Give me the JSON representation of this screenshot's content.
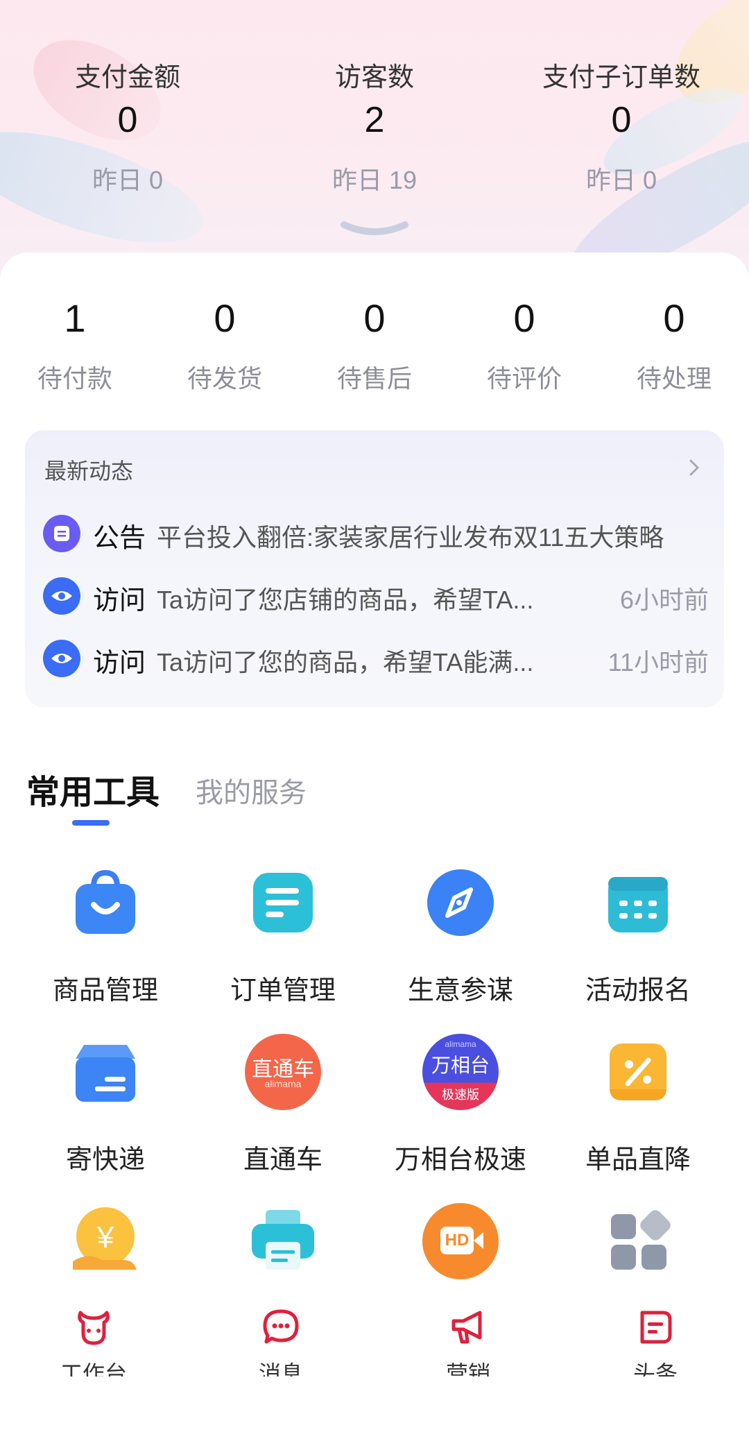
{
  "stats": [
    {
      "label": "支付金额",
      "value": "0",
      "yesterday": "昨日 0"
    },
    {
      "label": "访客数",
      "value": "2",
      "yesterday": "昨日 19"
    },
    {
      "label": "支付子订单数",
      "value": "0",
      "yesterday": "昨日 0"
    }
  ],
  "orders": [
    {
      "count": "1",
      "label": "待付款"
    },
    {
      "count": "0",
      "label": "待发货"
    },
    {
      "count": "0",
      "label": "待售后"
    },
    {
      "count": "0",
      "label": "待评价"
    },
    {
      "count": "0",
      "label": "待处理"
    }
  ],
  "news": {
    "title": "最新动态",
    "items": [
      {
        "icon": "announcement-icon",
        "tag": "公告",
        "text": "平台投入翻倍:家装家居行业发布双11五大策略",
        "time": ""
      },
      {
        "icon": "eye-icon",
        "tag": "访问",
        "text": "Ta访问了您店铺的商品，希望TA...",
        "time": "6小时前"
      },
      {
        "icon": "eye-icon",
        "tag": "访问",
        "text": "Ta访问了您的商品，希望TA能满...",
        "time": "11小时前"
      }
    ]
  },
  "tabs": {
    "active": "常用工具",
    "inactive": "我的服务"
  },
  "tools": [
    {
      "name": "商品管理",
      "icon": "shopping-bag-icon"
    },
    {
      "name": "订单管理",
      "icon": "order-list-icon"
    },
    {
      "name": "生意参谋",
      "icon": "compass-icon"
    },
    {
      "name": "活动报名",
      "icon": "calendar-icon"
    },
    {
      "name": "寄快递",
      "icon": "delivery-box-icon"
    },
    {
      "name": "直通车",
      "icon": "zhitongche-logo"
    },
    {
      "name": "万相台极速",
      "icon": "wanxiangtai-logo"
    },
    {
      "name": "单品直降",
      "icon": "discount-coupon-icon"
    },
    {
      "name": "",
      "icon": "yuan-hand-icon"
    },
    {
      "name": "",
      "icon": "printer-icon"
    },
    {
      "name": "",
      "icon": "hd-video-icon"
    },
    {
      "name": "",
      "icon": "more-apps-icon"
    }
  ],
  "logo_text": {
    "zhitongche": "直通车",
    "zhitongche_sub": "alimama",
    "wanxiangtai": "万相台",
    "wanxiangtai_top": "alimama",
    "wanxiangtai_badge": "极速版",
    "hd": "HD",
    "yuan": "¥"
  },
  "nav": [
    {
      "label": "工作台",
      "icon": "bull-head-icon"
    },
    {
      "label": "消息",
      "icon": "chat-bubble-icon"
    },
    {
      "label": "营销",
      "icon": "megaphone-icon"
    },
    {
      "label": "头条",
      "icon": "news-icon"
    }
  ],
  "colors": {
    "accent": "#3a6cf5",
    "nav": "#e0203c",
    "bg_hero": "#fde8ef"
  }
}
